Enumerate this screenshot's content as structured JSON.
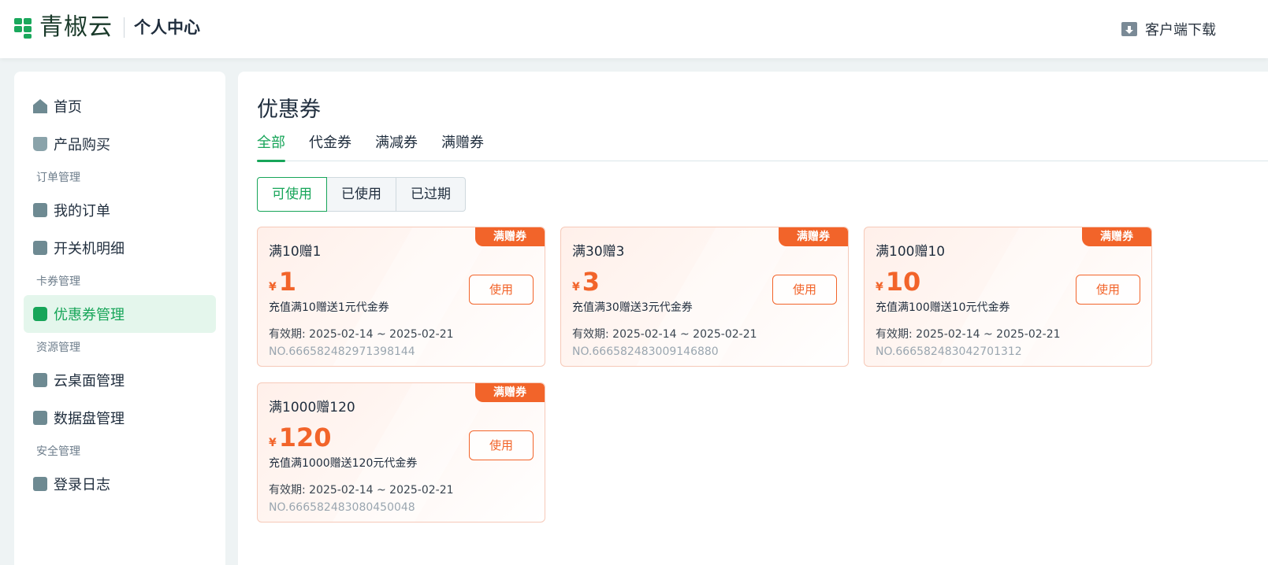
{
  "header": {
    "logo_text": "青椒云",
    "section_title": "个人中心",
    "download_label": "客户端下载"
  },
  "sidebar": {
    "items": [
      {
        "type": "item",
        "label": "首页",
        "icon": "home-icon"
      },
      {
        "type": "item",
        "label": "产品购买",
        "icon": "shopping-bag-icon"
      },
      {
        "type": "group",
        "label": "订单管理"
      },
      {
        "type": "item",
        "label": "我的订单",
        "icon": "clipboard-icon"
      },
      {
        "type": "item",
        "label": "开关机明细",
        "icon": "checklist-icon"
      },
      {
        "type": "group",
        "label": "卡券管理"
      },
      {
        "type": "item",
        "label": "优惠券管理",
        "icon": "ticket-icon",
        "active": true
      },
      {
        "type": "group",
        "label": "资源管理"
      },
      {
        "type": "item",
        "label": "云桌面管理",
        "icon": "monitor-icon"
      },
      {
        "type": "item",
        "label": "数据盘管理",
        "icon": "disk-icon"
      },
      {
        "type": "group",
        "label": "安全管理"
      },
      {
        "type": "item",
        "label": "登录日志",
        "icon": "document-icon"
      }
    ]
  },
  "main": {
    "title": "优惠券",
    "tabs": [
      {
        "label": "全部",
        "active": true
      },
      {
        "label": "代金券"
      },
      {
        "label": "满减券"
      },
      {
        "label": "满赠券"
      }
    ],
    "status_filters": [
      {
        "label": "可使用",
        "active": true
      },
      {
        "label": "已使用"
      },
      {
        "label": "已过期"
      }
    ],
    "coupons": [
      {
        "badge": "满赠券",
        "name": "满10赠1",
        "currency": "¥",
        "amount": "1",
        "desc": "充值满10赠送1元代金券",
        "valid": "有效期: 2025-02-14 ~ 2025-02-21",
        "no": "NO.666582482971398144",
        "button": "使用"
      },
      {
        "badge": "满赠券",
        "name": "满30赠3",
        "currency": "¥",
        "amount": "3",
        "desc": "充值满30赠送3元代金券",
        "valid": "有效期: 2025-02-14 ~ 2025-02-21",
        "no": "NO.666582483009146880",
        "button": "使用"
      },
      {
        "badge": "满赠券",
        "name": "满100赠10",
        "currency": "¥",
        "amount": "10",
        "desc": "充值满100赠送10元代金券",
        "valid": "有效期: 2025-02-14 ~ 2025-02-21",
        "no": "NO.666582483042701312",
        "button": "使用"
      },
      {
        "badge": "满赠券",
        "name": "满1000赠120",
        "currency": "¥",
        "amount": "120",
        "desc": "充值满1000赠送120元代金券",
        "valid": "有效期: 2025-02-14 ~ 2025-02-21",
        "no": "NO.666582483080450048",
        "button": "使用"
      }
    ]
  },
  "colors": {
    "brand_green": "#17a559",
    "coupon_orange": "#f2642a"
  }
}
